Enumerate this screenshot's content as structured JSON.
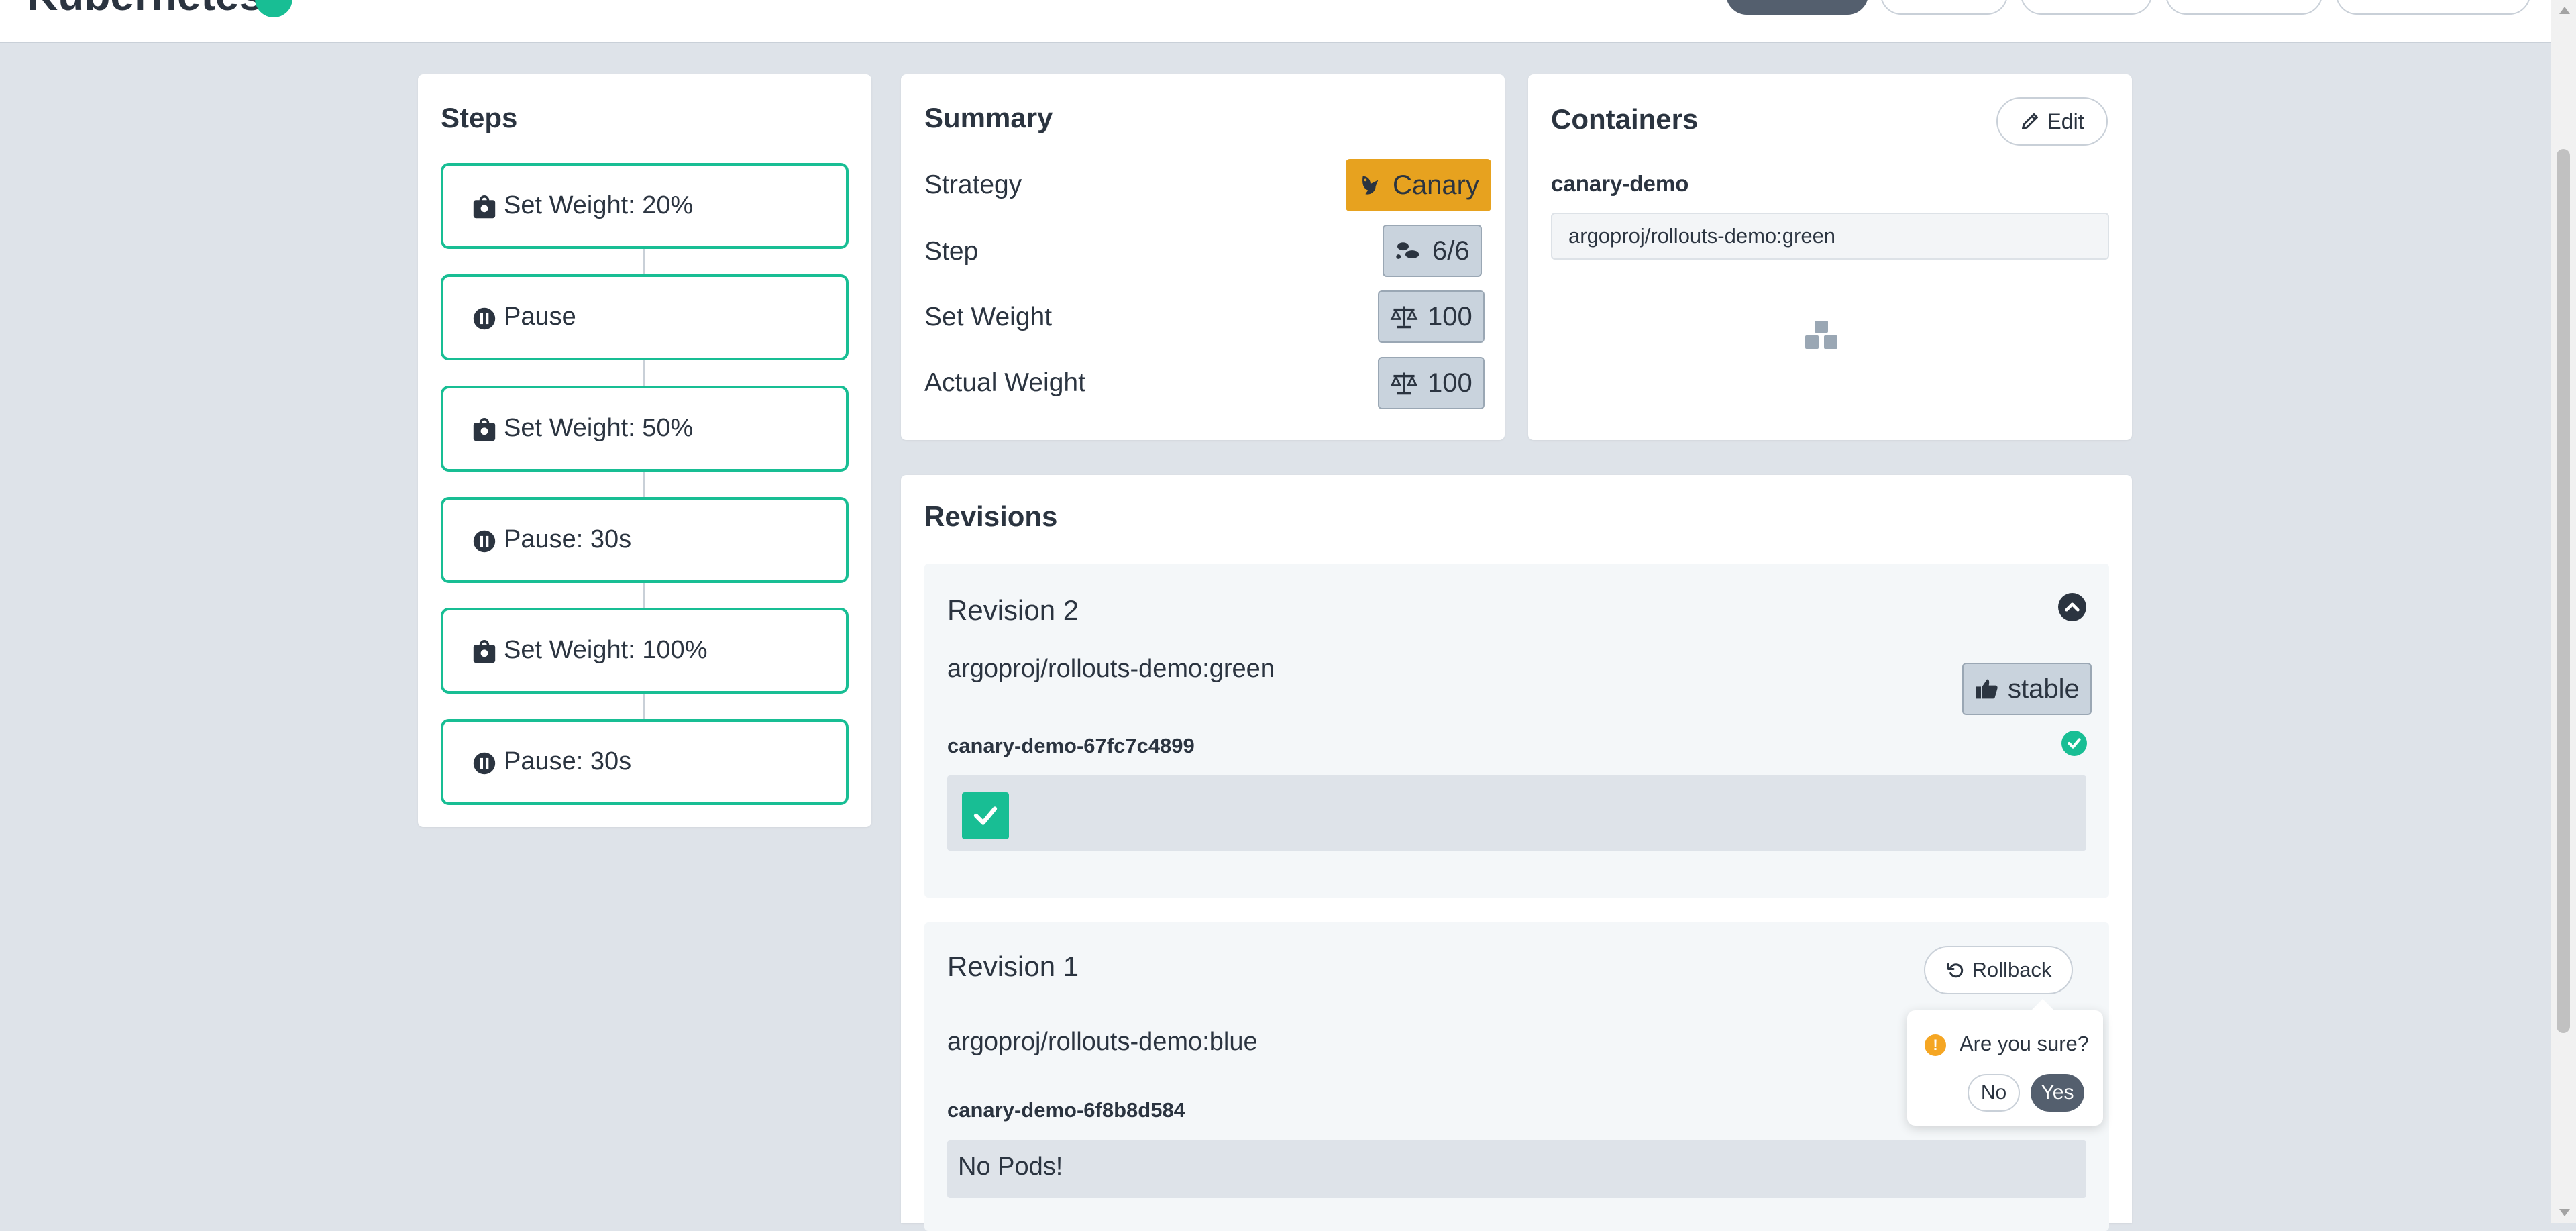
{
  "steps": {
    "title": "Steps",
    "items": [
      {
        "label": "Set Weight: 20%",
        "icon": "weight-icon"
      },
      {
        "label": "Pause",
        "icon": "pause-icon"
      },
      {
        "label": "Set Weight: 50%",
        "icon": "weight-icon"
      },
      {
        "label": "Pause: 30s",
        "icon": "pause-icon"
      },
      {
        "label": "Set Weight: 100%",
        "icon": "weight-icon"
      },
      {
        "label": "Pause: 30s",
        "icon": "pause-icon"
      }
    ]
  },
  "summary": {
    "title": "Summary",
    "strategy_label": "Strategy",
    "strategy_value": "Canary",
    "step_label": "Step",
    "step_value": "6/6",
    "set_weight_label": "Set Weight",
    "set_weight_value": "100",
    "actual_weight_label": "Actual Weight",
    "actual_weight_value": "100"
  },
  "containers": {
    "title": "Containers",
    "edit_label": "Edit",
    "name": "canary-demo",
    "image": "argoproj/rollouts-demo:green"
  },
  "revisions": {
    "title": "Revisions",
    "items": [
      {
        "title": "Revision 2",
        "image": "argoproj/rollouts-demo:green",
        "badge": "stable",
        "replicaset": "canary-demo-67fc7c4899"
      },
      {
        "title": "Revision 1",
        "image": "argoproj/rollouts-demo:blue",
        "rollback_label": "Rollback",
        "replicaset": "canary-demo-6f8b8d584",
        "pods_empty": "No Pods!"
      }
    ]
  },
  "popconfirm": {
    "message": "Are you sure?",
    "no_label": "No",
    "yes_label": "Yes"
  },
  "colors": {
    "accent": "#18be94",
    "canary": "#e7a21f",
    "background": "#dee3e9",
    "text": "#2b3440"
  }
}
